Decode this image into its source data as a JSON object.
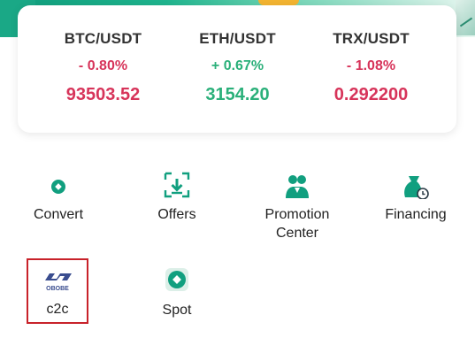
{
  "tickers": [
    {
      "pair": "BTC/USDT",
      "change": "- 0.80%",
      "price": "93503.52",
      "trend": "down"
    },
    {
      "pair": "ETH/USDT",
      "change": "+ 0.67%",
      "price": "3154.20",
      "trend": "up"
    },
    {
      "pair": "TRX/USDT",
      "change": "- 1.08%",
      "price": "0.292200",
      "trend": "down"
    }
  ],
  "menu": {
    "convert": {
      "label": "Convert",
      "icon": "convert-icon"
    },
    "offers": {
      "label": "Offers",
      "icon": "download-icon"
    },
    "promotion": {
      "label_line1": "Promotion",
      "label_line2": "Center",
      "icon": "users-icon"
    },
    "financing": {
      "label": "Financing",
      "icon": "money-bag-icon"
    },
    "c2c": {
      "label": "c2c",
      "logo_text": "OBOBE",
      "icon": "c2c-logo-icon"
    },
    "spot": {
      "label": "Spot",
      "icon": "spot-icon"
    }
  },
  "colors": {
    "down": "#d7345a",
    "up": "#2bb07a",
    "brand": "#119f7f",
    "highlight_box": "#c8222a"
  }
}
